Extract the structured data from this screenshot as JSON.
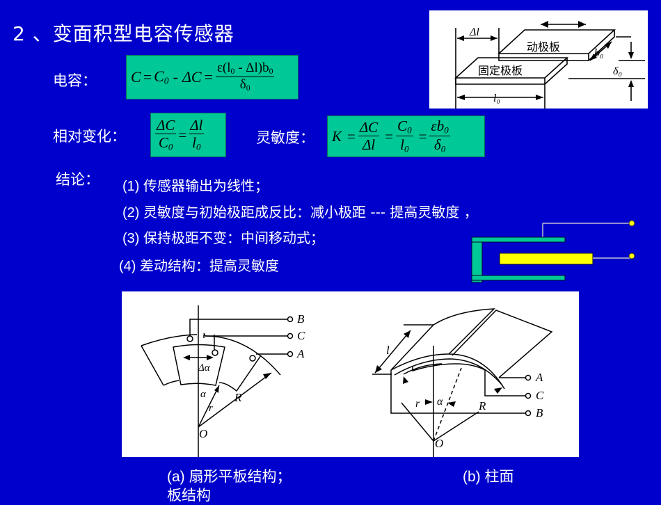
{
  "slide": {
    "title": "2 、变面积型电容传感器",
    "capacitance_label": "电容：",
    "relative_change_label": "相对变化：",
    "sensitivity_label": "灵敏度：",
    "conclusion_label": "结论："
  },
  "formulas": {
    "capacitance": {
      "lhs": "C",
      "eq1": "=",
      "c0": "C",
      "c0_sub": "0",
      "minus": "-",
      "deltaC": "ΔC",
      "eq2": "=",
      "numerator": "ε(l",
      "num_sub": "0",
      "num_mid": " - Δl)b",
      "num_sub2": "0",
      "denominator": "δ",
      "den_sub": "0"
    },
    "relative_change": {
      "num1": "ΔC",
      "den1": "C",
      "den1_sub": "0",
      "eq": "=",
      "num2": "Δl",
      "den2": "l",
      "den2_sub": "0"
    },
    "sensitivity": {
      "lhs": "K",
      "eq1": "=",
      "num1": "ΔC",
      "den1": "Δl",
      "eq2": "=",
      "num2": "C",
      "num2_sub": "0",
      "den2": "l",
      "den2_sub": "0",
      "eq3": "=",
      "num3": "εb",
      "num3_sub": "0",
      "den3": "δ",
      "den3_sub": "0"
    }
  },
  "conclusions": [
    {
      "prefix": "(1) ",
      "text": "传感器输出为线性；"
    },
    {
      "prefix": "(2) ",
      "text": "灵敏度与初始极距成反比：减小极距   --- 提高灵敏度  ，"
    },
    {
      "prefix": "(3) ",
      "text": "保持极距不变：中间移动式；"
    },
    {
      "prefix": "(4) ",
      "text": "差动结构：提高灵敏度"
    }
  ],
  "plate_diagram": {
    "delta_l": "Δl",
    "moving_plate": "动极板",
    "fixed_plate": "固定极板",
    "b0": "b₀",
    "delta0": "δ₀",
    "l0": "l₀"
  },
  "differential_diagram": {
    "colors": {
      "outer": "#00C896",
      "inner": "#FFFF00",
      "terminal": "#FFFF00"
    }
  },
  "fan_diagram": {
    "terminals": [
      "B",
      "C",
      "A"
    ],
    "delta_alpha": "Δα",
    "alpha": "α",
    "r": "r",
    "R": "R",
    "origin": "O"
  },
  "cylinder_diagram": {
    "l": "l",
    "terminals": [
      "A",
      "C",
      "B"
    ],
    "alpha": "α",
    "r": "r",
    "R": "R",
    "origin": "O"
  },
  "captions": {
    "a": "(a) 扇形平板结构；",
    "b": "(b) 柱面",
    "b_continued": "板结构"
  },
  "colors": {
    "background": "#0000CC",
    "formula_box": "#00C896",
    "text": "#FFFFFF"
  }
}
